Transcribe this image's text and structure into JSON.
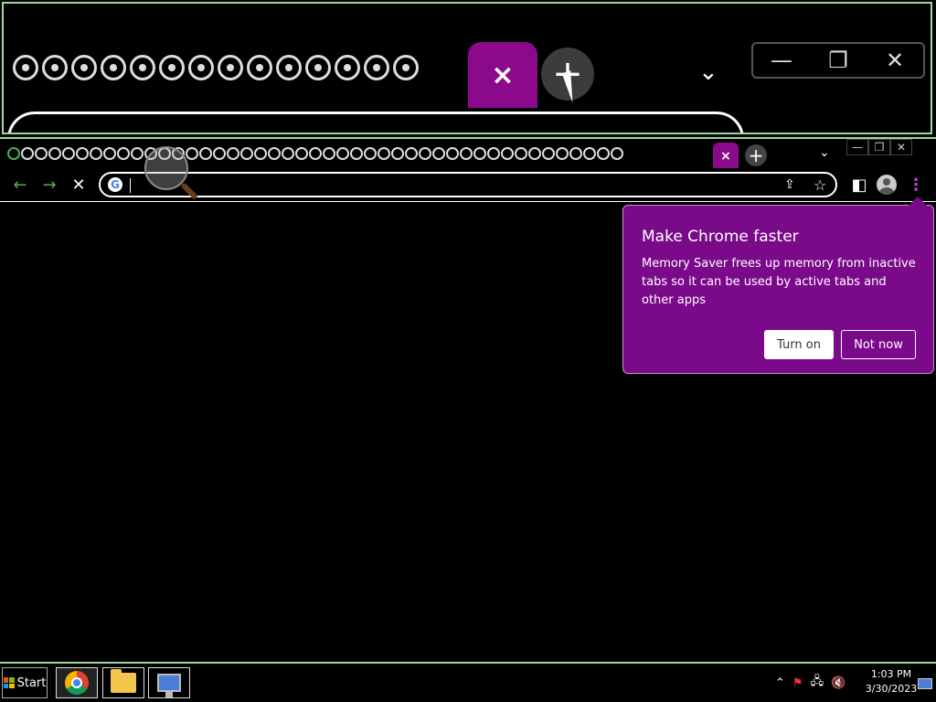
{
  "magnifier": {
    "active_tab_close": "×",
    "new_tab_symbol": "+",
    "chevron": "⌄",
    "minimize": "—",
    "restore": "❐",
    "close": "✕"
  },
  "tabstrip": {
    "tab_icon_count": 45,
    "active_tab_close": "×",
    "new_tab_symbol": "+",
    "tab_search_symbol": "⌄",
    "window_controls": {
      "minimize": "—",
      "restore": "❐",
      "close": "✕"
    }
  },
  "toolbar": {
    "back_icon": "←",
    "forward_icon": "→",
    "stop_icon": "✕",
    "omnibox": {
      "logo": "G",
      "value": "",
      "placeholder": ""
    },
    "share_icon": "⇪",
    "star_icon": "☆",
    "side_panel_icon": "◧",
    "menu_icon": "⋮"
  },
  "popup": {
    "title": "Make Chrome faster",
    "body": "Memory Saver frees up memory from inactive tabs so it can be used by active tabs and other apps",
    "turn_on": "Turn on",
    "not_now": "Not now"
  },
  "taskbar": {
    "start_label": "Start",
    "tray": {
      "show_hidden": "⌃",
      "flag": "⚑",
      "network": "🖧",
      "volume": "🔇"
    },
    "clock": {
      "time": "1:03 PM",
      "date": "3/30/2023"
    }
  },
  "colors": {
    "accent_purple": "#7a0a8a",
    "green_nav": "#4caf50",
    "border_green": "#9fd79f"
  }
}
